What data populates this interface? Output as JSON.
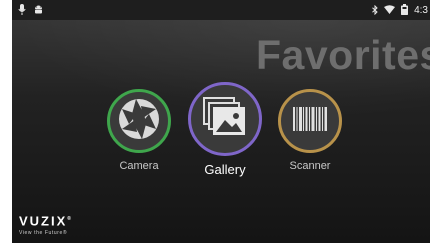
{
  "status_bar": {
    "left_icons": [
      "mic-icon",
      "android-icon"
    ],
    "right_icons": [
      "bluetooth-icon",
      "wifi-icon",
      "battery-icon"
    ],
    "time": "4:3"
  },
  "page": {
    "title": "Favorites"
  },
  "apps": [
    {
      "label": "Camera",
      "icon": "camera-shutter-icon",
      "ring_color": "#3fa64c"
    },
    {
      "label": "Gallery",
      "icon": "gallery-photos-icon",
      "ring_color": "#7f66c9",
      "selected": true
    },
    {
      "label": "Scanner",
      "icon": "barcode-icon",
      "ring_color": "#b8924a"
    }
  ],
  "branding": {
    "logo": "VUZIX",
    "trademark": "®",
    "tagline": "View the Future®"
  }
}
